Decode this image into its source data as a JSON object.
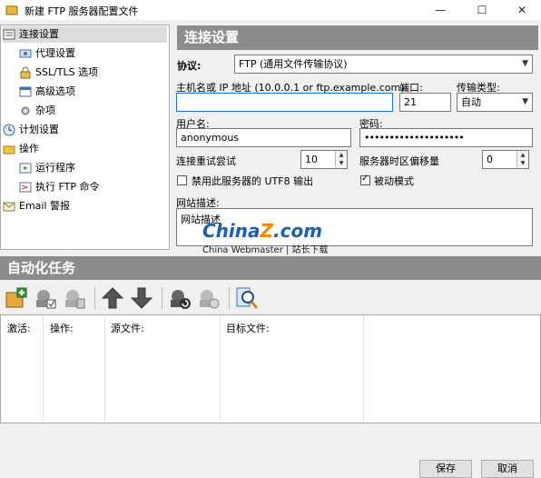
{
  "window": {
    "title": "新建 FTP 服务器配置文件",
    "controls": [
      "—",
      "☐",
      "✕"
    ]
  },
  "tree": {
    "items": [
      {
        "label": "连接设置",
        "icon": "connection-icon"
      },
      {
        "label": "代理设置",
        "icon": "proxy-icon"
      },
      {
        "label": "SSL/TLS 选项",
        "icon": "ssl-icon"
      },
      {
        "label": "高级选项",
        "icon": "advanced-icon"
      },
      {
        "label": "杂项",
        "icon": "misc-icon"
      },
      {
        "label": "计划设置",
        "icon": "clock-icon"
      },
      {
        "label": "操作",
        "icon": "folder-icon"
      },
      {
        "label": "运行程序",
        "icon": "run-icon"
      },
      {
        "label": "执行 FTP 命令",
        "icon": "command-icon"
      },
      {
        "label": "Email 警报",
        "icon": "email-icon"
      }
    ]
  },
  "panel": {
    "heading": "连接设置",
    "protocol_label": "协议:",
    "protocol_value": "FTP (通用文件传输协议)",
    "host_label": "主机名或 IP 地址 (10.0.0.1 or ftp.example.com):",
    "host_value": "",
    "port_label": "端口:",
    "port_value": "21",
    "transfer_label": "传输类型:",
    "transfer_value": "自动",
    "user_label": "用户名:",
    "user_value": "anonymous",
    "password_label": "密码:",
    "password_value": "••••••••••••••••••••",
    "retry_label": "连接重试尝试",
    "retry_value": "10",
    "tz_label": "服务器时区偏移量",
    "tz_value": "0",
    "utf8_label": "禁用此服务器的 UTF8 输出",
    "utf8_checked": false,
    "passive_label": "被动模式",
    "passive_checked": true,
    "desc_label": "网站描述:",
    "desc_value": "网站描述"
  },
  "watermark": {
    "brand_a": "China",
    "brand_z": "Z",
    "brand_b": ".com",
    "sub": "China Webmaster | 站长下载"
  },
  "auto": {
    "heading": "自动化任务",
    "toolbar_icons": [
      "add-task-icon",
      "edit-task-icon",
      "delete-task-icon",
      "move-up-icon",
      "move-down-icon",
      "refresh-icon",
      "disable-icon",
      "search-icon"
    ],
    "columns": [
      "激活:",
      "操作:",
      "源文件:",
      "目标文件:"
    ]
  },
  "buttons": {
    "save": "保存",
    "cancel": "取消"
  },
  "colors": {
    "header_gray": "#8c8c8c",
    "focus_blue": "#1e6fd9",
    "arrow_gray": "#555555",
    "watermark_blue": "#1a5fb4",
    "watermark_orange": "#f08a00"
  }
}
